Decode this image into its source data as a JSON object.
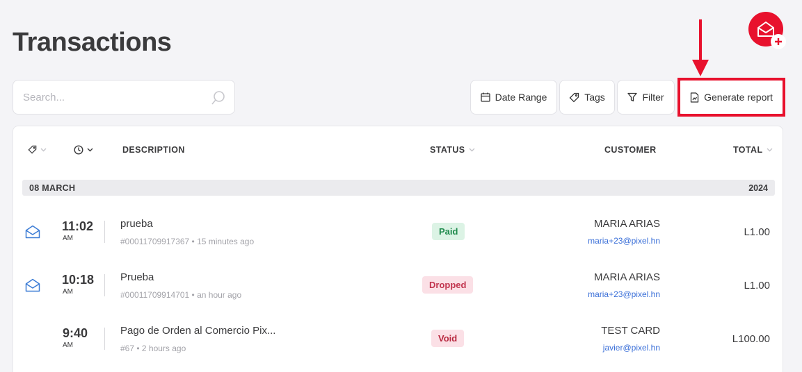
{
  "page": {
    "title": "Transactions"
  },
  "search": {
    "placeholder": "Search...",
    "value": ""
  },
  "toolbar": {
    "date_range": "Date Range",
    "tags": "Tags",
    "filter": "Filter",
    "generate_report": "Generate report"
  },
  "colors": {
    "accent": "#e8112d",
    "link": "#3a6fd8"
  },
  "table": {
    "headers": {
      "description": "DESCRIPTION",
      "status": "STATUS",
      "customer": "CUSTOMER",
      "total": "TOTAL"
    },
    "group": {
      "date": "08 MARCH",
      "year": "2024"
    },
    "rows": [
      {
        "icon": "envelope-icon",
        "time": "11:02",
        "ampm": "AM",
        "title": "prueba",
        "sub": "#00011709917367 • 15 minutes ago",
        "status": "Paid",
        "customer": "MARIA ARIAS",
        "email": "maria+23@pixel.hn",
        "total": "L1.00"
      },
      {
        "icon": "envelope-icon",
        "time": "10:18",
        "ampm": "AM",
        "title": "Prueba",
        "sub": "#00011709914701 • an hour ago",
        "status": "Dropped",
        "customer": "MARIA ARIAS",
        "email": "maria+23@pixel.hn",
        "total": "L1.00"
      },
      {
        "icon": "",
        "time": "9:40",
        "ampm": "AM",
        "title": "Pago de Orden al Comercio Pix...",
        "sub": "#67 • 2 hours ago",
        "status": "Void",
        "customer": "TEST CARD",
        "email": "javier@pixel.hn",
        "total": "L100.00"
      }
    ]
  }
}
